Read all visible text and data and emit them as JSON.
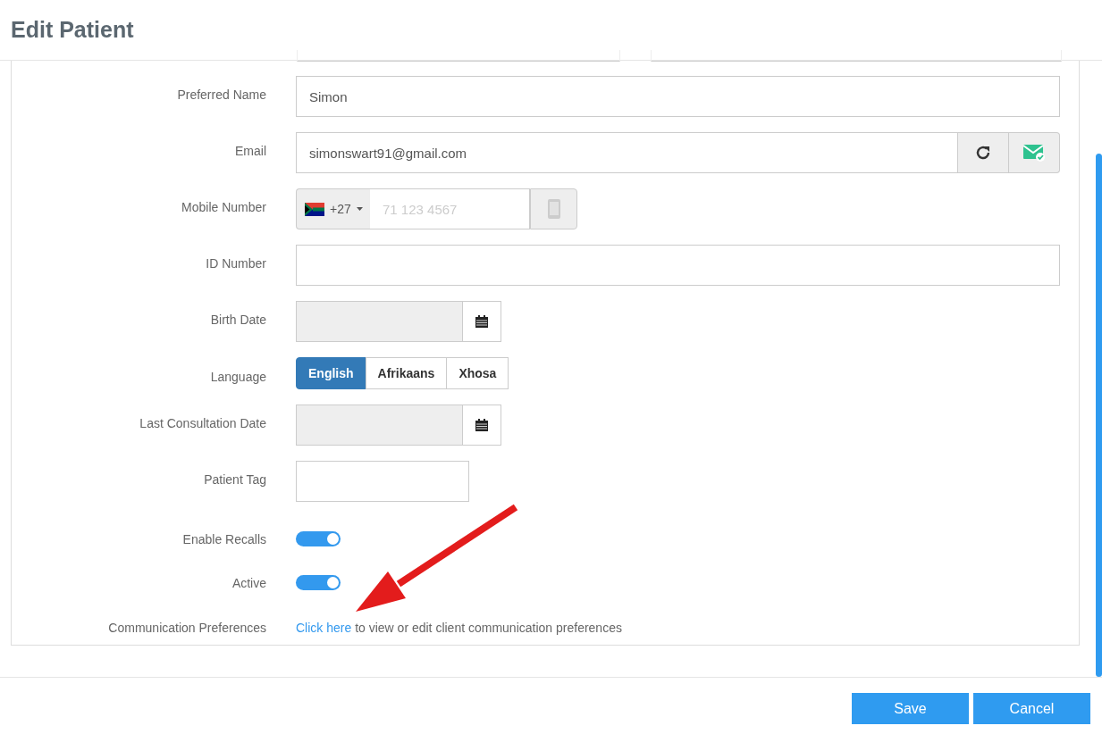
{
  "window": {
    "title": "Edit Patient"
  },
  "fields": [
    {
      "kind": "text",
      "label": "Preferred Name",
      "value": "Simon"
    },
    {
      "kind": "email",
      "label": "Email",
      "value": "simonswart91@gmail.com"
    },
    {
      "kind": "phone",
      "label": "Mobile Number",
      "country_code": "+27",
      "placeholder": "71 123 4567"
    },
    {
      "kind": "text",
      "label": "ID Number"
    },
    {
      "kind": "date",
      "label": "Birth Date"
    },
    {
      "kind": "choice",
      "label": "Language",
      "options": [
        {
          "label": "English",
          "selected": true
        },
        {
          "label": "Afrikaans",
          "selected": false
        },
        {
          "label": "Xhosa",
          "selected": false
        }
      ]
    },
    {
      "kind": "date",
      "label": "Last Consultation Date"
    },
    {
      "kind": "tag",
      "label": "Patient Tag"
    },
    {
      "kind": "toggle",
      "label": "Enable Recalls",
      "on": true
    },
    {
      "kind": "toggle",
      "label": "Active",
      "on": true
    },
    {
      "kind": "link",
      "label": "Communication Preferences",
      "link": "Click here",
      "text": "to view or edit client communication preferences"
    }
  ],
  "buttons": [
    {
      "label": "Save"
    },
    {
      "label": "Cancel"
    }
  ]
}
